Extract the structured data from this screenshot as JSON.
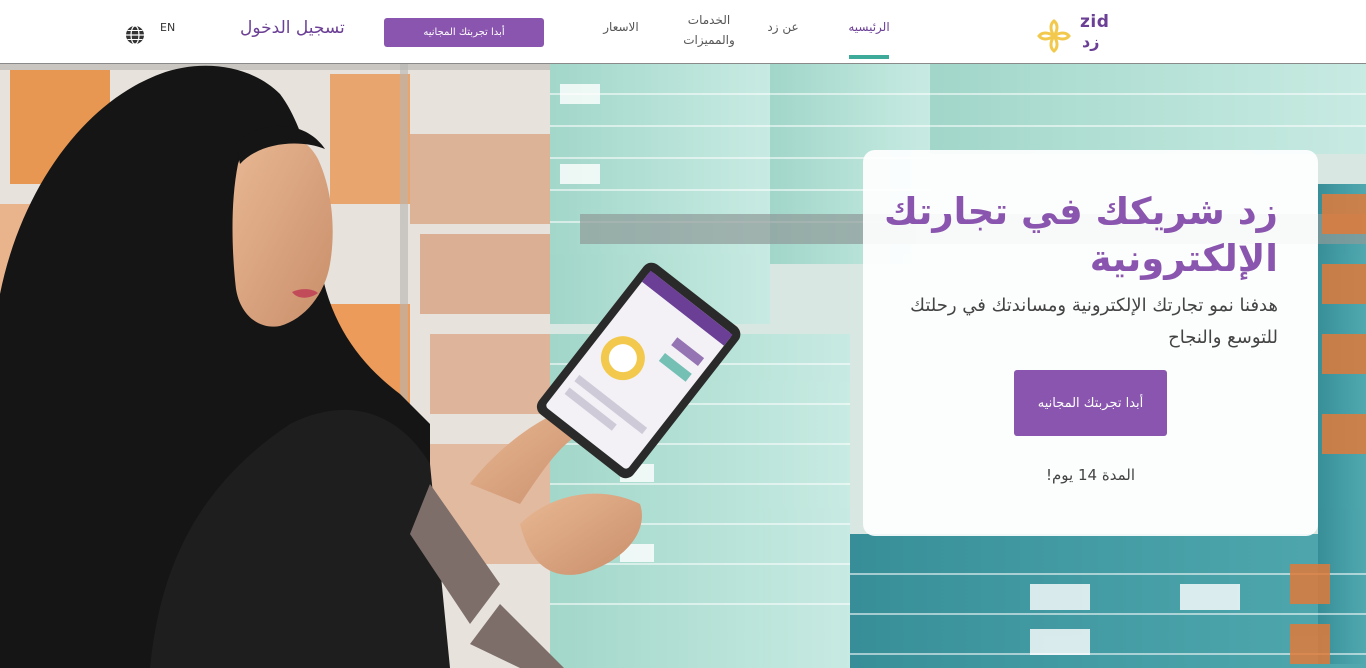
{
  "header": {
    "lang_label": "EN",
    "login_label": "تسجيل الدخول",
    "trial_button_label": "أبدا تجربتك المجانيه",
    "nav": {
      "pricing": "الاسعار",
      "services_line1": "الخدمات",
      "services_line2": "والمميزات",
      "about": "عن زد",
      "home": "الرئيسيه"
    },
    "logo": {
      "latin": "zid",
      "arabic": "زد"
    }
  },
  "hero": {
    "title": "زد شريكك في تجارتك الإلكترونية",
    "subtitle": "هدفنا نمو تجارتك الإلكترونية ومساندتك في رحلتك للتوسع والنجاح",
    "cta_label": "أبدا تجربتك المجانيه",
    "duration": "!المدة 14 يوم"
  },
  "icons": {
    "language": "globe-icon",
    "logo_mark": "zid-flower-logo"
  },
  "colors": {
    "brand_purple": "#8a55ae",
    "brand_purple_dark": "#6b3f95",
    "nav_active_underline": "#3eab9a",
    "logo_yellow": "#f2c94c"
  }
}
